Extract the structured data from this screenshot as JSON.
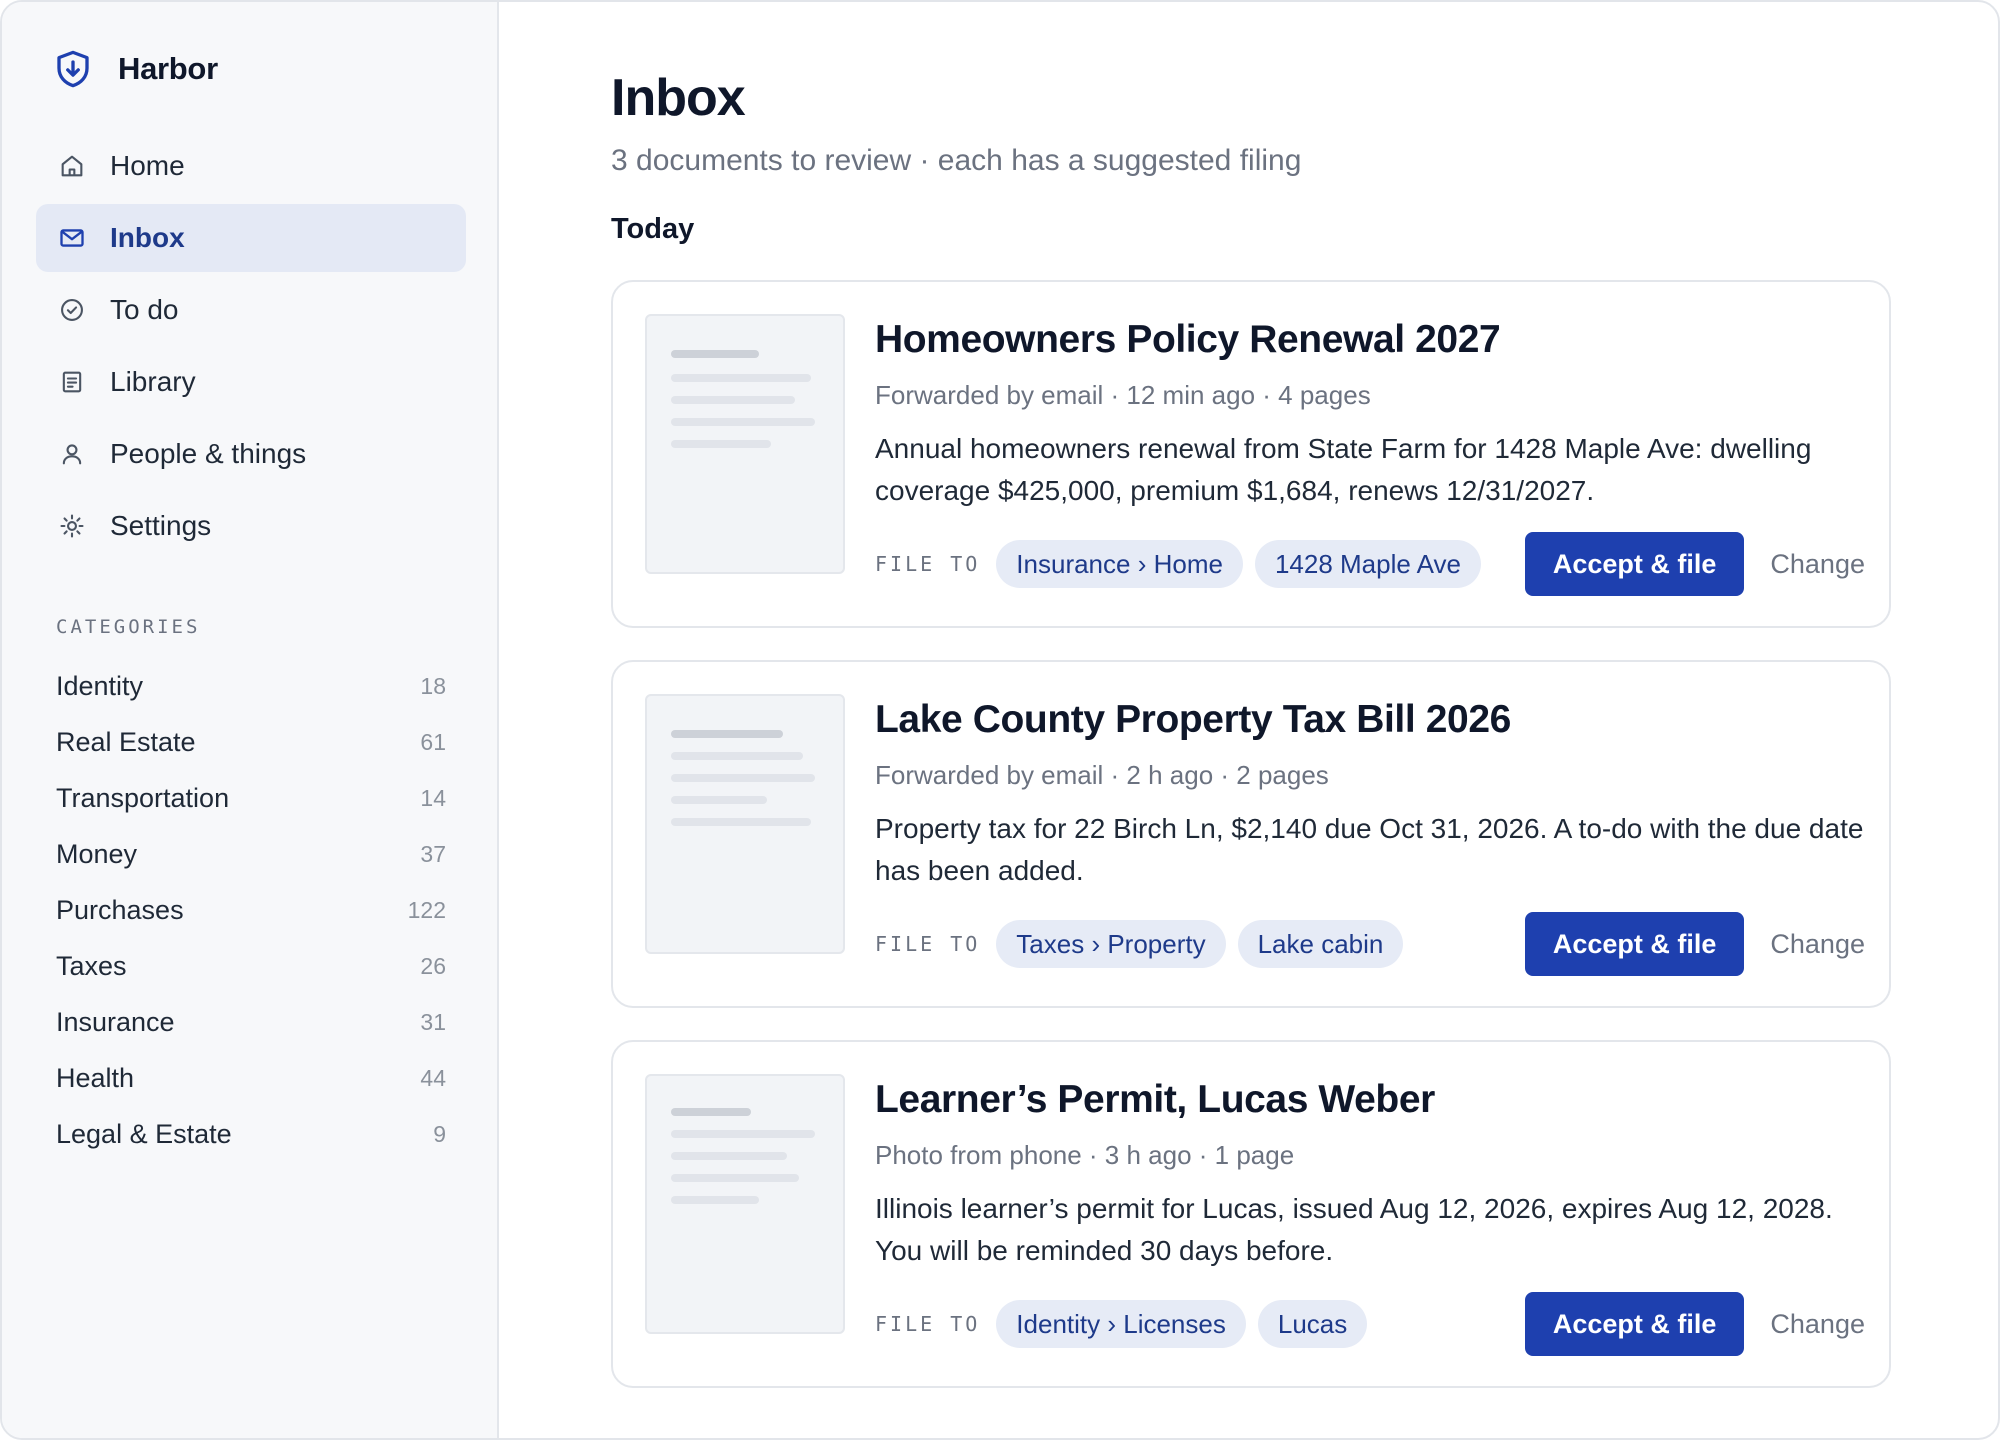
{
  "app": {
    "name": "Harbor",
    "accent_color": "#1e40af",
    "icon": "shield-download-icon"
  },
  "nav": [
    {
      "label": "Home",
      "icon": "home-icon",
      "active": false
    },
    {
      "label": "Inbox",
      "icon": "mail-icon",
      "active": true
    },
    {
      "label": "To do",
      "icon": "check-circle-icon",
      "active": false
    },
    {
      "label": "Library",
      "icon": "document-list-icon",
      "active": false
    },
    {
      "label": "People & things",
      "icon": "person-icon",
      "active": false
    },
    {
      "label": "Settings",
      "icon": "gear-icon",
      "active": false
    }
  ],
  "categories": {
    "header": "CATEGORIES",
    "items": [
      {
        "label": "Identity",
        "count": "18"
      },
      {
        "label": "Real Estate",
        "count": "61"
      },
      {
        "label": "Transportation",
        "count": "14"
      },
      {
        "label": "Money",
        "count": "37"
      },
      {
        "label": "Purchases",
        "count": "122"
      },
      {
        "label": "Taxes",
        "count": "26"
      },
      {
        "label": "Insurance",
        "count": "31"
      },
      {
        "label": "Health",
        "count": "44"
      },
      {
        "label": "Legal & Estate",
        "count": "9"
      }
    ]
  },
  "main": {
    "title": "Inbox",
    "subtitle": "3 documents to review · each has a suggested filing",
    "section": "Today",
    "file_to_label": "FILE TO",
    "accept_label": "Accept & file",
    "change_label": "Change",
    "cards": [
      {
        "title": "Homeowners Policy Renewal 2027",
        "meta": "Forwarded by email · 12 min ago · 4 pages",
        "description": "Annual homeowners renewal from State Farm for 1428 Maple Ave: dwelling coverage $425,000, premium $1,684, renews 12/31/2027.",
        "chips": [
          "Insurance › Home",
          "1428 Maple Ave"
        ]
      },
      {
        "title": "Lake County Property Tax Bill 2026",
        "meta": "Forwarded by email · 2 h ago · 2 pages",
        "description": "Property tax for 22 Birch Ln, $2,140 due Oct 31, 2026. A to-do with the due date has been added.",
        "chips": [
          "Taxes › Property",
          "Lake cabin"
        ]
      },
      {
        "title": "Learner’s Permit, Lucas Weber",
        "meta": "Photo from phone · 3 h ago · 1 page",
        "description": "Illinois learner’s permit for Lucas, issued Aug 12, 2026, expires Aug 12, 2028. You will be reminded 30 days before.",
        "chips": [
          "Identity › Licenses",
          "Lucas"
        ]
      }
    ]
  }
}
